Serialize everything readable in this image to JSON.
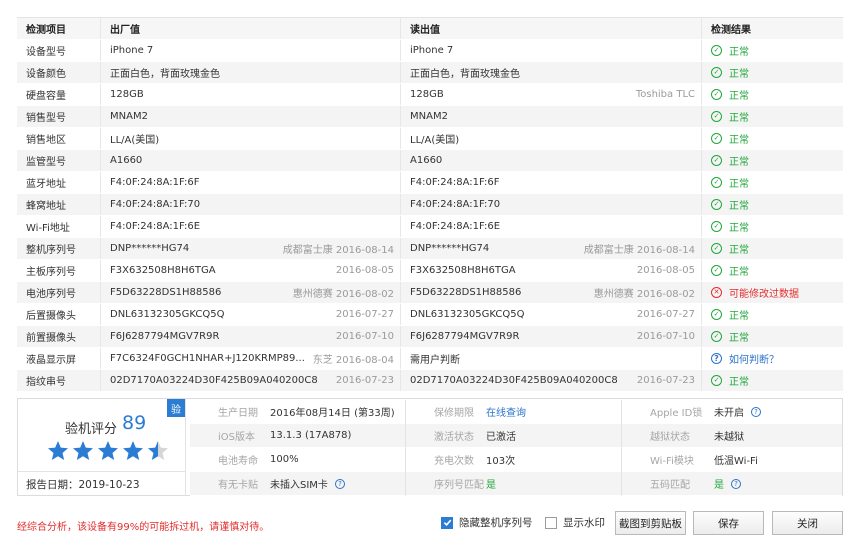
{
  "table": {
    "headers": [
      "检测项目",
      "出厂值",
      "读出值",
      "检测结果"
    ],
    "rows": [
      {
        "item": "设备型号",
        "factory": "iPhone 7",
        "factory_note": "",
        "read": "iPhone 7",
        "read_note": "",
        "status": "ok",
        "result": "正常"
      },
      {
        "item": "设备颜色",
        "factory": "正面白色，背面玫瑰金色",
        "factory_note": "",
        "read": "正面白色，背面玫瑰金色",
        "read_note": "",
        "status": "ok",
        "result": "正常"
      },
      {
        "item": "硬盘容量",
        "factory": "128GB",
        "factory_note": "",
        "read": "128GB",
        "read_note": "Toshiba TLC",
        "status": "ok",
        "result": "正常"
      },
      {
        "item": "销售型号",
        "factory": "MNAM2",
        "factory_note": "",
        "read": "MNAM2",
        "read_note": "",
        "status": "ok",
        "result": "正常"
      },
      {
        "item": "销售地区",
        "factory": "LL/A(美国)",
        "factory_note": "",
        "read": "LL/A(美国)",
        "read_note": "",
        "status": "ok",
        "result": "正常"
      },
      {
        "item": "监管型号",
        "factory": "A1660",
        "factory_note": "",
        "read": "A1660",
        "read_note": "",
        "status": "ok",
        "result": "正常"
      },
      {
        "item": "蓝牙地址",
        "factory": "F4:0F:24:8A:1F:6F",
        "factory_note": "",
        "read": "F4:0F:24:8A:1F:6F",
        "read_note": "",
        "status": "ok",
        "result": "正常"
      },
      {
        "item": "蜂窝地址",
        "factory": "F4:0F:24:8A:1F:70",
        "factory_note": "",
        "read": "F4:0F:24:8A:1F:70",
        "read_note": "",
        "status": "ok",
        "result": "正常"
      },
      {
        "item": "Wi-Fi地址",
        "factory": "F4:0F:24:8A:1F:6E",
        "factory_note": "",
        "read": "F4:0F:24:8A:1F:6E",
        "read_note": "",
        "status": "ok",
        "result": "正常"
      },
      {
        "item": "整机序列号",
        "factory": "DNP******HG74",
        "factory_note": "成都富士康 2016-08-14",
        "read": "DNP******HG74",
        "read_note": "成都富士康 2016-08-14",
        "status": "ok",
        "result": "正常"
      },
      {
        "item": "主板序列号",
        "factory": "F3X632508H8H6TGA",
        "factory_note": "2016-08-05",
        "read": "F3X632508H8H6TGA",
        "read_note": "2016-08-05",
        "status": "ok",
        "result": "正常"
      },
      {
        "item": "电池序列号",
        "factory": "F5D63228DS1H88586",
        "factory_note": "惠州德赛 2016-08-02",
        "read": "F5D63228DS1H88586",
        "read_note": "惠州德赛 2016-08-02",
        "status": "bad",
        "result": "可能修改过数据"
      },
      {
        "item": "后置摄像头",
        "factory": "DNL63132305GKCQ5Q",
        "factory_note": "2016-07-27",
        "read": "DNL63132305GKCQ5Q",
        "read_note": "2016-07-27",
        "status": "ok",
        "result": "正常"
      },
      {
        "item": "前置摄像头",
        "factory": "F6J6287794MGV7R9R",
        "factory_note": "2016-07-10",
        "read": "F6J6287794MGV7R9R",
        "read_note": "2016-07-10",
        "status": "ok",
        "result": "正常"
      },
      {
        "item": "液晶显示屏",
        "factory": "F7C6324F0GCH1NHAR+J120KRMP89...",
        "factory_note": "东芝 2016-08-04",
        "read": "需用户判断",
        "read_note": "",
        "status": "ask",
        "result": "如何判断？"
      },
      {
        "item": "指纹串号",
        "factory": "02D7170A03224D30F425B09A040200C8",
        "factory_note": "2016-07-23",
        "read": "02D7170A03224D30F425B09A040200C8",
        "read_note": "2016-07-23",
        "status": "ok",
        "result": "正常"
      }
    ]
  },
  "summary": {
    "score_label": "验机评分",
    "score": "89",
    "badge": "验",
    "stars": 4.5,
    "report_date": "报告日期：2019-10-23",
    "col1": [
      {
        "label": "生产日期",
        "value": "2016年08月14日 (第33周)"
      },
      {
        "label": "iOS版本",
        "value": "13.1.3 (17A878)"
      },
      {
        "label": "电池寿命",
        "value": "100%"
      },
      {
        "label": "有无卡贴",
        "value": "未插入SIM卡"
      }
    ],
    "col2": [
      {
        "label": "保修期限",
        "value": "在线查询"
      },
      {
        "label": "激活状态",
        "value": "已激活"
      },
      {
        "label": "充电次数",
        "value": "103次"
      },
      {
        "label": "序列号匹配",
        "value": "是"
      }
    ],
    "col3": [
      {
        "label": "Apple ID锁",
        "value": "未开启"
      },
      {
        "label": "越狱状态",
        "value": "未越狱"
      },
      {
        "label": "Wi-Fi模块",
        "value": "低温Wi-Fi"
      },
      {
        "label": "五码匹配",
        "value": "是"
      }
    ]
  },
  "footer": {
    "warning": "经综合分析，该设备有99%的可能拆过机，请谨慎对待。",
    "hide_serial": "隐藏整机序列号",
    "hide_serial_checked": true,
    "watermark": "显示水印",
    "watermark_checked": false,
    "copy_btn": "截图到剪贴板",
    "save_btn": "保存",
    "close_btn": "关闭"
  },
  "colors": {
    "accent": "#2b7cd3",
    "ok": "#21a63b",
    "bad": "#e32d2d"
  }
}
